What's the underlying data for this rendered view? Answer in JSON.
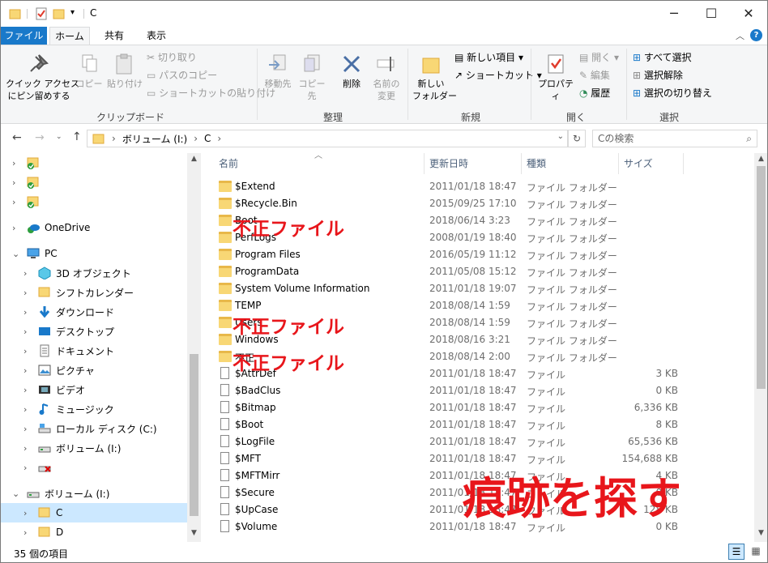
{
  "window": {
    "title": "C"
  },
  "tabs": [
    "ファイル",
    "ホーム",
    "共有",
    "表示"
  ],
  "ribbon": {
    "clipboard": {
      "pin": "クイック アクセス\nにピン留めする",
      "copy": "コピー",
      "paste": "貼り付け",
      "cut": "切り取り",
      "copy_path": "パスのコピー",
      "paste_shortcut": "ショートカットの貼り付け",
      "label": "クリップボード"
    },
    "organize": {
      "move_to": "移動先",
      "copy_to": "コピー先",
      "delete": "削除",
      "rename": "名前の\n変更",
      "label": "整理"
    },
    "new": {
      "new_folder": "新しい\nフォルダー",
      "new_item": "新しい項目",
      "shortcut": "ショートカット",
      "label": "新規"
    },
    "open": {
      "properties": "プロパティ",
      "open": "開く",
      "edit": "編集",
      "history": "履歴",
      "label": "開く"
    },
    "select": {
      "select_all": "すべて選択",
      "select_none": "選択解除",
      "invert": "選択の切り替え",
      "label": "選択"
    }
  },
  "address": {
    "crumb1": "ボリューム (I:)",
    "crumb2": "C",
    "search_placeholder": "Cの検索"
  },
  "nav": [
    {
      "label": "",
      "icon": "folder-check-icon",
      "indent": 0
    },
    {
      "label": "",
      "icon": "folder-check-icon",
      "indent": 0
    },
    {
      "label": "",
      "icon": "folder-check-icon",
      "indent": 0
    },
    {
      "label": "OneDrive",
      "icon": "onedrive-icon",
      "indent": 0
    },
    {
      "label": "PC",
      "icon": "pc-icon",
      "indent": 0
    },
    {
      "label": "3D オブジェクト",
      "icon": "3d-icon",
      "indent": 1
    },
    {
      "label": "シフトカレンダー",
      "icon": "folder-icon",
      "indent": 1
    },
    {
      "label": "ダウンロード",
      "icon": "download-icon",
      "indent": 1
    },
    {
      "label": "デスクトップ",
      "icon": "desktop-icon",
      "indent": 1
    },
    {
      "label": "ドキュメント",
      "icon": "document-icon",
      "indent": 1
    },
    {
      "label": "ピクチャ",
      "icon": "picture-icon",
      "indent": 1
    },
    {
      "label": "ビデオ",
      "icon": "video-icon",
      "indent": 1
    },
    {
      "label": "ミュージック",
      "icon": "music-icon",
      "indent": 1
    },
    {
      "label": "ローカル ディスク (C:)",
      "icon": "disk-icon",
      "indent": 1
    },
    {
      "label": "ボリューム (I:)",
      "icon": "drive-icon",
      "indent": 1
    },
    {
      "label": "",
      "icon": "drive-x-icon",
      "indent": 1
    },
    {
      "label": "ボリューム (I:)",
      "icon": "drive-icon",
      "indent": 0
    },
    {
      "label": "C",
      "icon": "folder-icon",
      "indent": 1
    },
    {
      "label": "D",
      "icon": "folder-icon",
      "indent": 1
    }
  ],
  "columns": {
    "name": "名前",
    "date": "更新日時",
    "type": "種類",
    "size": "サイズ"
  },
  "files": [
    {
      "name": "$Extend",
      "date": "2011/01/18 18:47",
      "type": "ファイル フォルダー",
      "size": "",
      "kind": "folder"
    },
    {
      "name": "$Recycle.Bin",
      "date": "2015/09/25 17:10",
      "type": "ファイル フォルダー",
      "size": "",
      "kind": "folder"
    },
    {
      "name": "Boot",
      "date": "2018/06/14 3:23",
      "type": "ファイル フォルダー",
      "size": "",
      "kind": "folder"
    },
    {
      "name": "PerfLogs",
      "date": "2008/01/19 18:40",
      "type": "ファイル フォルダー",
      "size": "",
      "kind": "folder"
    },
    {
      "name": "Program Files",
      "date": "2016/05/19 11:12",
      "type": "ファイル フォルダー",
      "size": "",
      "kind": "folder"
    },
    {
      "name": "ProgramData",
      "date": "2011/05/08 15:12",
      "type": "ファイル フォルダー",
      "size": "",
      "kind": "folder"
    },
    {
      "name": "System Volume Information",
      "date": "2011/01/18 19:07",
      "type": "ファイル フォルダー",
      "size": "",
      "kind": "folder"
    },
    {
      "name": "TEMP",
      "date": "2018/08/14 1:59",
      "type": "ファイル フォルダー",
      "size": "",
      "kind": "folder"
    },
    {
      "name": "Users",
      "date": "2018/08/14 1:59",
      "type": "ファイル フォルダー",
      "size": "",
      "kind": "folder"
    },
    {
      "name": "Windows",
      "date": "2018/08/16 3:21",
      "type": "ファイル フォルダー",
      "size": "",
      "kind": "folder"
    },
    {
      "name": "不正",
      "date": "2018/08/14 2:00",
      "type": "ファイル フォルダー",
      "size": "",
      "kind": "folder"
    },
    {
      "name": "$AttrDef",
      "date": "2011/01/18 18:47",
      "type": "ファイル",
      "size": "3 KB",
      "kind": "file"
    },
    {
      "name": "$BadClus",
      "date": "2011/01/18 18:47",
      "type": "ファイル",
      "size": "0 KB",
      "kind": "file"
    },
    {
      "name": "$Bitmap",
      "date": "2011/01/18 18:47",
      "type": "ファイル",
      "size": "6,336 KB",
      "kind": "file"
    },
    {
      "name": "$Boot",
      "date": "2011/01/18 18:47",
      "type": "ファイル",
      "size": "8 KB",
      "kind": "file"
    },
    {
      "name": "$LogFile",
      "date": "2011/01/18 18:47",
      "type": "ファイル",
      "size": "65,536 KB",
      "kind": "file"
    },
    {
      "name": "$MFT",
      "date": "2011/01/18 18:47",
      "type": "ファイル",
      "size": "154,688 KB",
      "kind": "file"
    },
    {
      "name": "$MFTMirr",
      "date": "2011/01/18 18:47",
      "type": "ファイル",
      "size": "4 KB",
      "kind": "file"
    },
    {
      "name": "$Secure",
      "date": "2011/01/18 18:47",
      "type": "ファイル",
      "size": "0 KB",
      "kind": "file"
    },
    {
      "name": "$UpCase",
      "date": "2011/01/18 18:47",
      "type": "ファイル",
      "size": "128 KB",
      "kind": "file"
    },
    {
      "name": "$Volume",
      "date": "2011/01/18 18:47",
      "type": "ファイル",
      "size": "0 KB",
      "kind": "file"
    }
  ],
  "status": {
    "count": "35 個の項目"
  },
  "overlays": {
    "fraud1": "不正ファイル",
    "fraud2": "不正ファイル",
    "fraud3": "不正ファイル",
    "headline": "痕跡を探す"
  },
  "colors": {
    "accent": "#1979ca",
    "overlay": "#e8161b",
    "selected": "#cce8ff"
  }
}
